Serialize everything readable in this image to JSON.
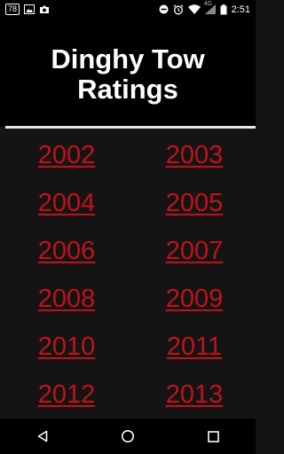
{
  "status_bar": {
    "notification_count": "78",
    "time": "2:51",
    "network": "4G",
    "icons": [
      "image-icon",
      "camera-icon",
      "do-not-disturb-icon",
      "alarm-icon",
      "wifi-icon",
      "signal-icon",
      "battery-icon"
    ]
  },
  "header": {
    "title": "Dinghy Tow\nRatings"
  },
  "years": [
    {
      "label": "2002"
    },
    {
      "label": "2003"
    },
    {
      "label": "2004"
    },
    {
      "label": "2005"
    },
    {
      "label": "2006"
    },
    {
      "label": "2007"
    },
    {
      "label": "2008"
    },
    {
      "label": "2009"
    },
    {
      "label": "2010"
    },
    {
      "label": "2011"
    },
    {
      "label": "2012"
    },
    {
      "label": "2013"
    }
  ],
  "colors": {
    "link": "#c1121a",
    "background": "#141414",
    "header_bg": "#000000",
    "divider": "#e8e8e8"
  },
  "nav_bar": {
    "icons": [
      "back-icon",
      "home-icon",
      "recents-icon"
    ]
  }
}
